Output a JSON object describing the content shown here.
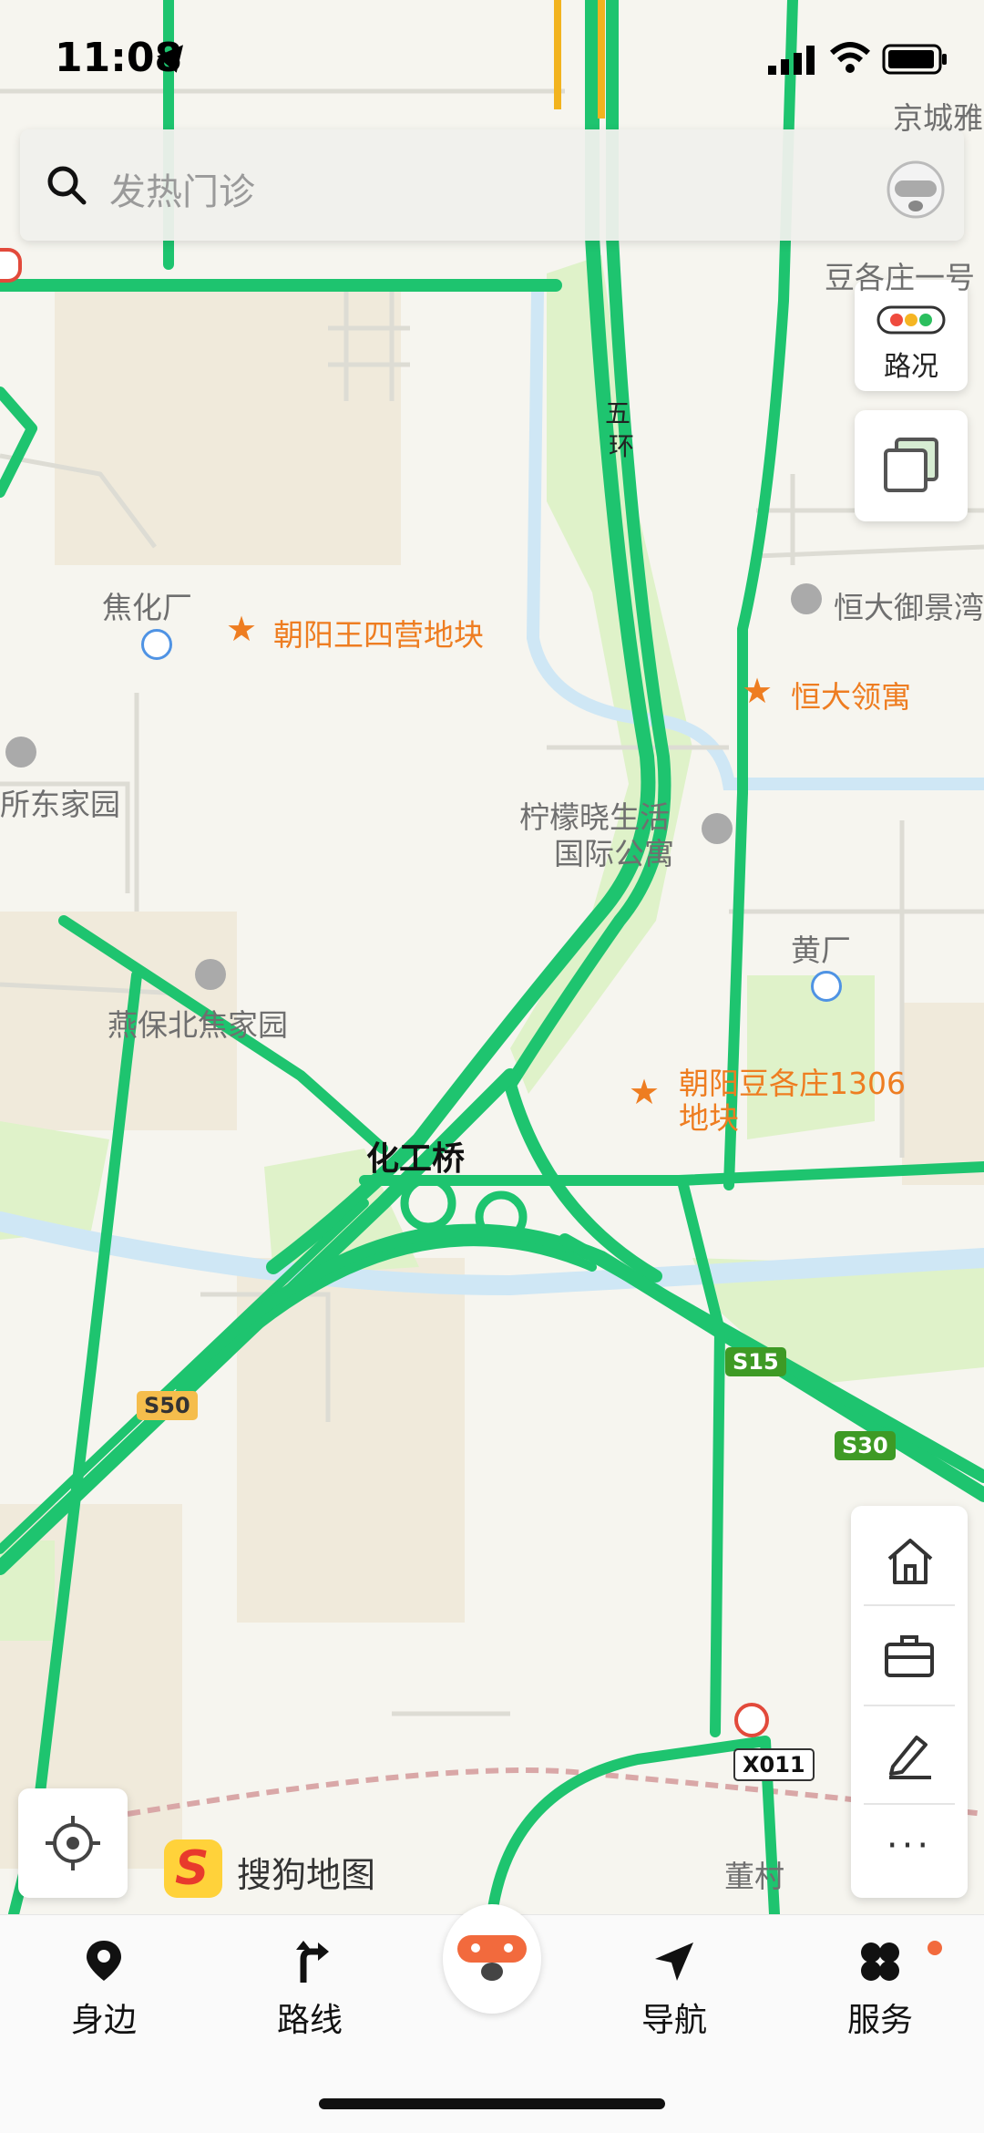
{
  "status_bar": {
    "time": "11:08"
  },
  "search": {
    "placeholder": "发热门诊"
  },
  "map_controls": {
    "traffic_label": "路况"
  },
  "map_labels": {
    "top_right_1": "京城雅",
    "top_right_2": "豆各庄一号",
    "ring_road_1": "五",
    "ring_road_2": "环",
    "jiaohuachang": "焦化厂",
    "poi_wangsiying": "朝阳王四营地块",
    "poi_hengda_yujing": "恒大御景湾",
    "poi_hengda_lingyu": "恒大领寓",
    "xindongjiayuan": "所东家园",
    "ningmeng_1": "柠檬晓生活",
    "ningmeng_2": "国际公寓",
    "huangchang": "黄厂",
    "yanbao": "燕保北焦家园",
    "poi_dougezhuang_1": "朝阳豆各庄1306",
    "poi_dougezhuang_2": "地块",
    "huagongqiao": "化工桥",
    "s50": "S50",
    "s15": "S15",
    "s30": "S30",
    "x011": "X011",
    "dongcun": "董村",
    "logo_text": "搜狗地图"
  },
  "bottom_nav": {
    "nearby": "身边",
    "route": "路线",
    "navigate": "导航",
    "service": "服务"
  },
  "colors": {
    "road_green": "#1ec46f",
    "poi_orange": "#ee7d21",
    "water_blue": "#cfe7f5",
    "park_green": "#dff2c9",
    "mascot_orange": "#f26a3d"
  }
}
